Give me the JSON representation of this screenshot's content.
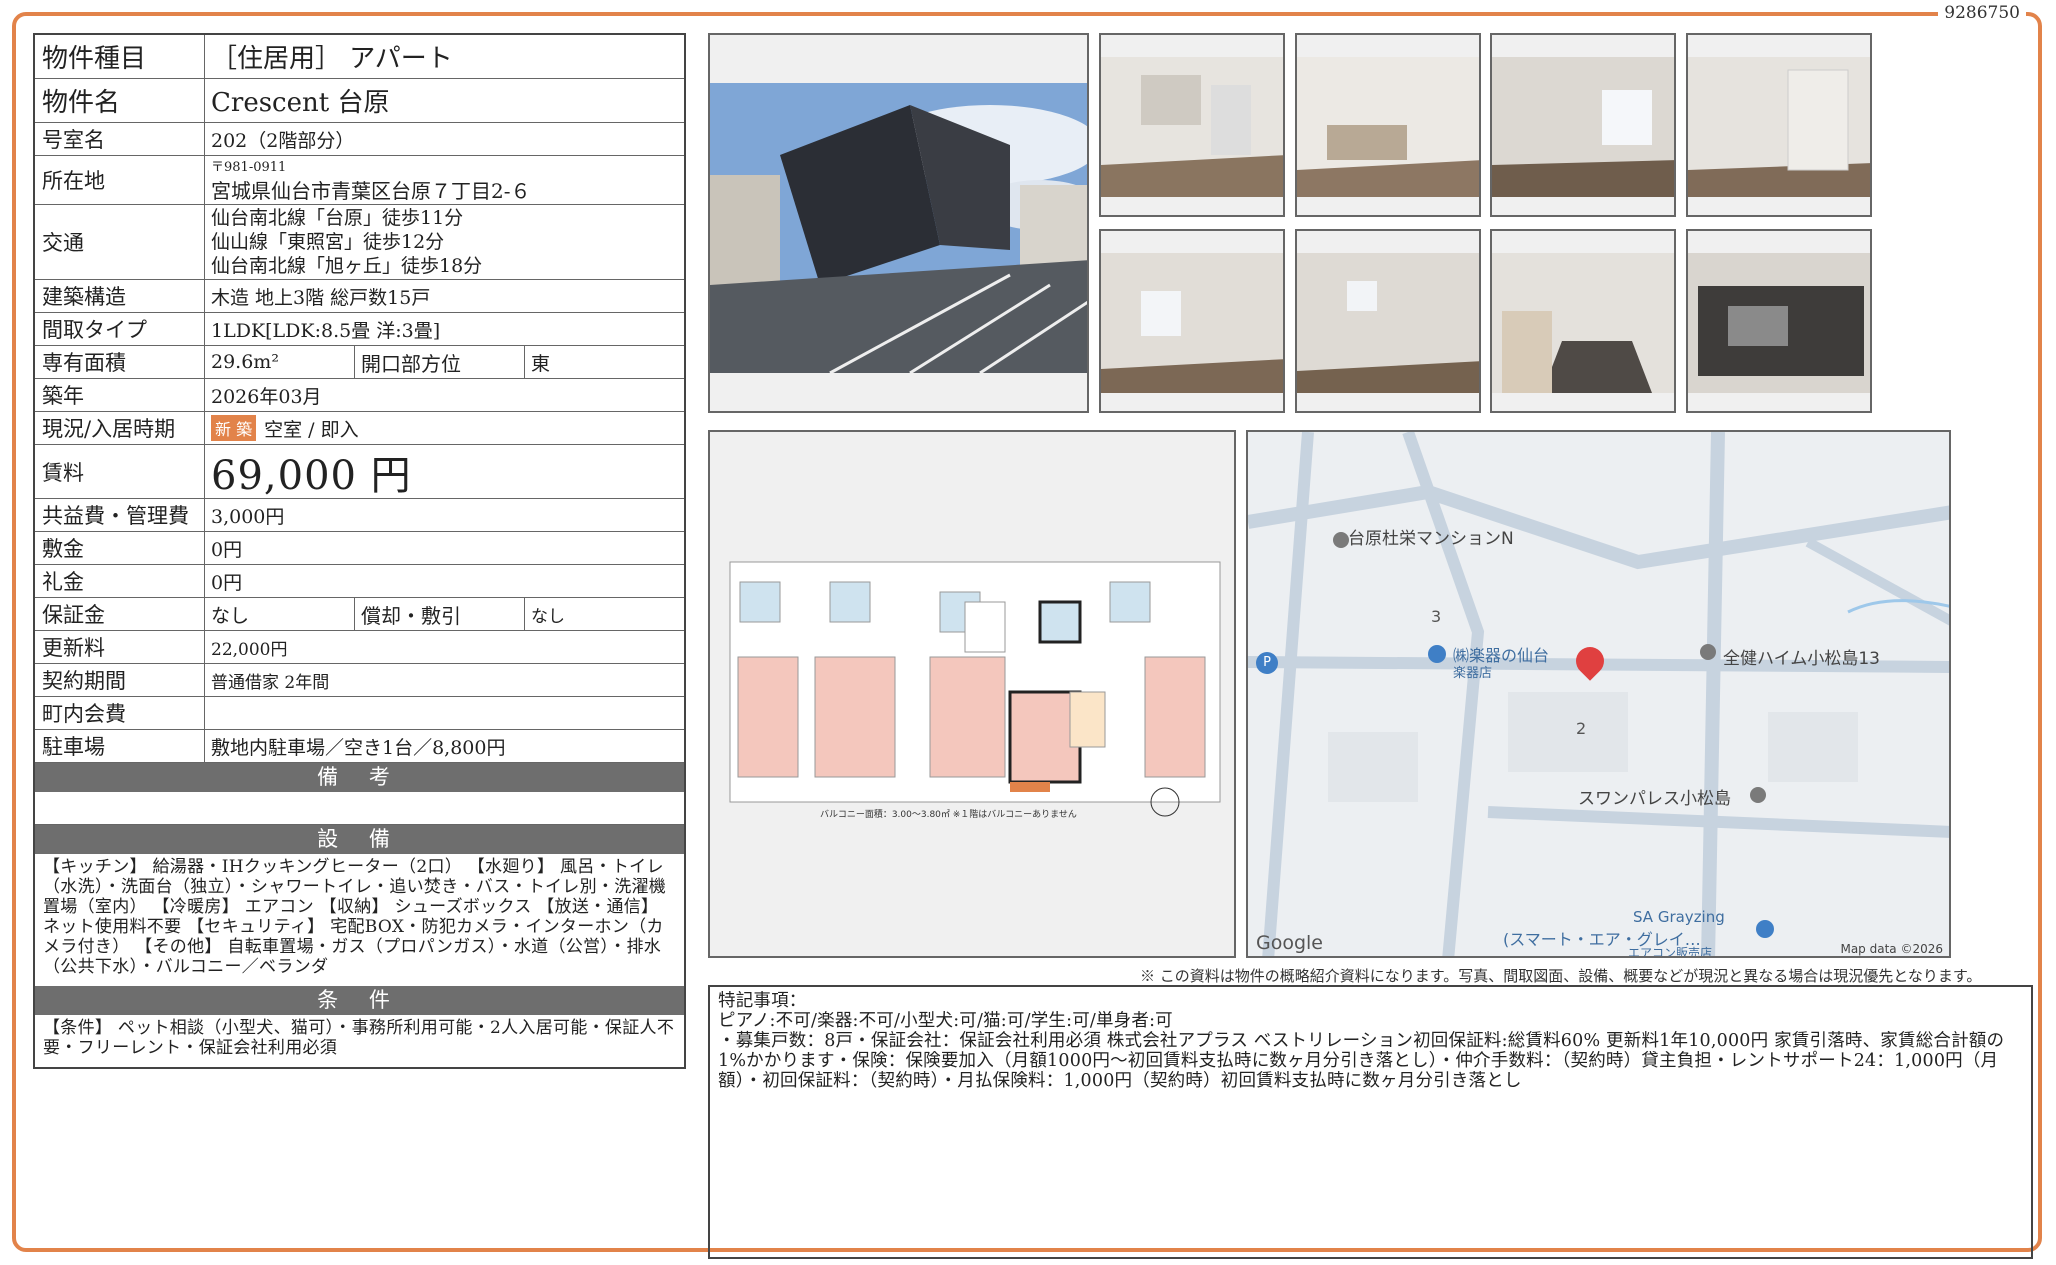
{
  "doc_id": "9286750",
  "property": {
    "type_label": "物件種目",
    "type_value": "［住居用］ アパート",
    "name_label": "物件名",
    "name_value": "Crescent 台原",
    "room_label": "号室名",
    "room_value": "202（2階部分）",
    "address_label": "所在地",
    "postal": "〒981-0911",
    "address": "宮城県仙台市青葉区台原７丁目2-６",
    "access_label": "交通",
    "access": [
      "仙台南北線「台原」徒歩11分",
      "仙山線「東照宮」徒歩12分",
      "仙台南北線「旭ヶ丘」徒歩18分"
    ],
    "structure_label": "建築構造",
    "structure_value": "木造  地上3階  総戸数15戸",
    "layout_label": "間取タイプ",
    "layout_value": "1LDK[LDK:8.5畳  洋:3畳]",
    "area_label": "専有面積",
    "area_value": "29.6m²",
    "direction_label": "開口部方位",
    "direction_value": "東",
    "built_label": "築年",
    "built_value": "2026年03月",
    "status_label": "現況/入居時期",
    "status_badge": "新 築",
    "status_value": "空室  /  即入",
    "rent_label": "賃料",
    "rent_value": "69,000 円",
    "fee_label": "共益費・管理費",
    "fee_value": "3,000円",
    "deposit_label": "敷金",
    "deposit_value": "0円",
    "key_label": "礼金",
    "key_value": "0円",
    "guarantee_label": "保証金",
    "guarantee_value": "なし",
    "amort_label": "償却・敷引",
    "amort_value": "なし",
    "renewal_label": "更新料",
    "renewal_value": "22,000円",
    "contract_label": "契約期間",
    "contract_value": "普通借家  2年間",
    "town_label": "町内会費",
    "town_value": "",
    "parking_label": "駐車場",
    "parking_value": "敷地内駐車場／空き1台／8,800円"
  },
  "remarks_title": "備 考",
  "remarks_text": "",
  "equipment_title": "設 備",
  "equipment_text": "【キッチン】 給湯器・IHクッキングヒーター（2口） 【水廻り】 風呂・トイレ（水洗）・洗面台（独立）・シャワートイレ・追い焚き・バス・トイレ別・洗濯機置場（室内） 【冷暖房】 エアコン 【収納】 シューズボックス 【放送・通信】 ネット使用料不要 【セキュリティ】 宅配BOX・防犯カメラ・インターホン（カメラ付き） 【その他】 自転車置場・ガス（プロパンガス）・水道（公営）・排水（公共下水）・バルコニー／ベランダ",
  "conditions_title": "条 件",
  "conditions_text": "【条件】 ペット相談（小型犬、猫可）・事務所利用可能・2人入居可能・保証人不要・フリーレント・保証会社利用必須",
  "map": {
    "labels": [
      "台原杜栄マンションN",
      "㈱楽器の仙台",
      "楽器店",
      "全健ハイム小松島13",
      "スワンパレス小松島",
      "SA Grayzing",
      "(スマート・エア・グレイ…",
      "エアコン販売店",
      "3",
      "2",
      "P",
      "Google",
      "Map data ©2026"
    ]
  },
  "plan_caption": "バルコニー面積：3.00～3.80㎡  ※１階はバルコニーありません",
  "disclaimer": "※ この資料は物件の概略紹介資料になります。写真、間取図面、設備、概要などが現況と異なる場合は現況優先となります。",
  "notes": {
    "title": "特記事項：",
    "line1": "ピアノ:不可/楽器:不可/小型犬:可/猫:可/学生:可/単身者:可",
    "line2": "・募集戸数：8戸・保証会社：保証会社利用必須 株式会社アプラス ベストリレーション初回保証料:総賃料60% 更新料1年10,000円  家賃引落時、家賃総合計額の1%かかります・保険：保険要加入（月額1000円～初回賃料支払時に数ヶ月分引き落とし）・仲介手数料：（契約時）貸主負担・レントサポート24：1,000円（月額）・初回保証料：（契約時）・月払保険料：1,000円（契約時）初回賃料支払時に数ヶ月分引き落とし"
  }
}
